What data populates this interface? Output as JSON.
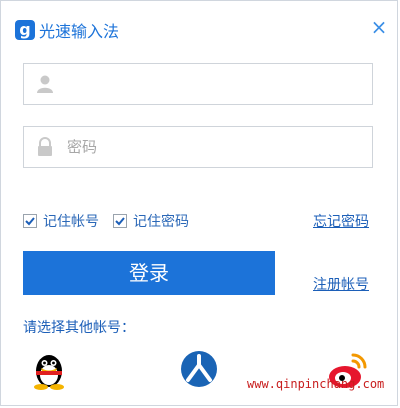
{
  "app": {
    "logo_letter": "g",
    "title": "光速输入法",
    "close_label": "×"
  },
  "form": {
    "username_placeholder": "",
    "password_placeholder": "密码"
  },
  "options": {
    "remember_account": "记住帐号",
    "remember_password": "记住密码",
    "remember_account_checked": true,
    "remember_password_checked": true
  },
  "links": {
    "forgot_password": "忘记密码",
    "register": "注册帐号"
  },
  "login": {
    "label": "登录"
  },
  "other": {
    "label": "请选择其他帐号：",
    "providers": [
      "qq-icon",
      "renren-icon",
      "weibo-icon"
    ]
  },
  "watermark": "www.qinpinchang.com",
  "colors": {
    "accent": "#1c73d9",
    "link": "#1c5fb8",
    "watermark": "#c81e1e"
  }
}
